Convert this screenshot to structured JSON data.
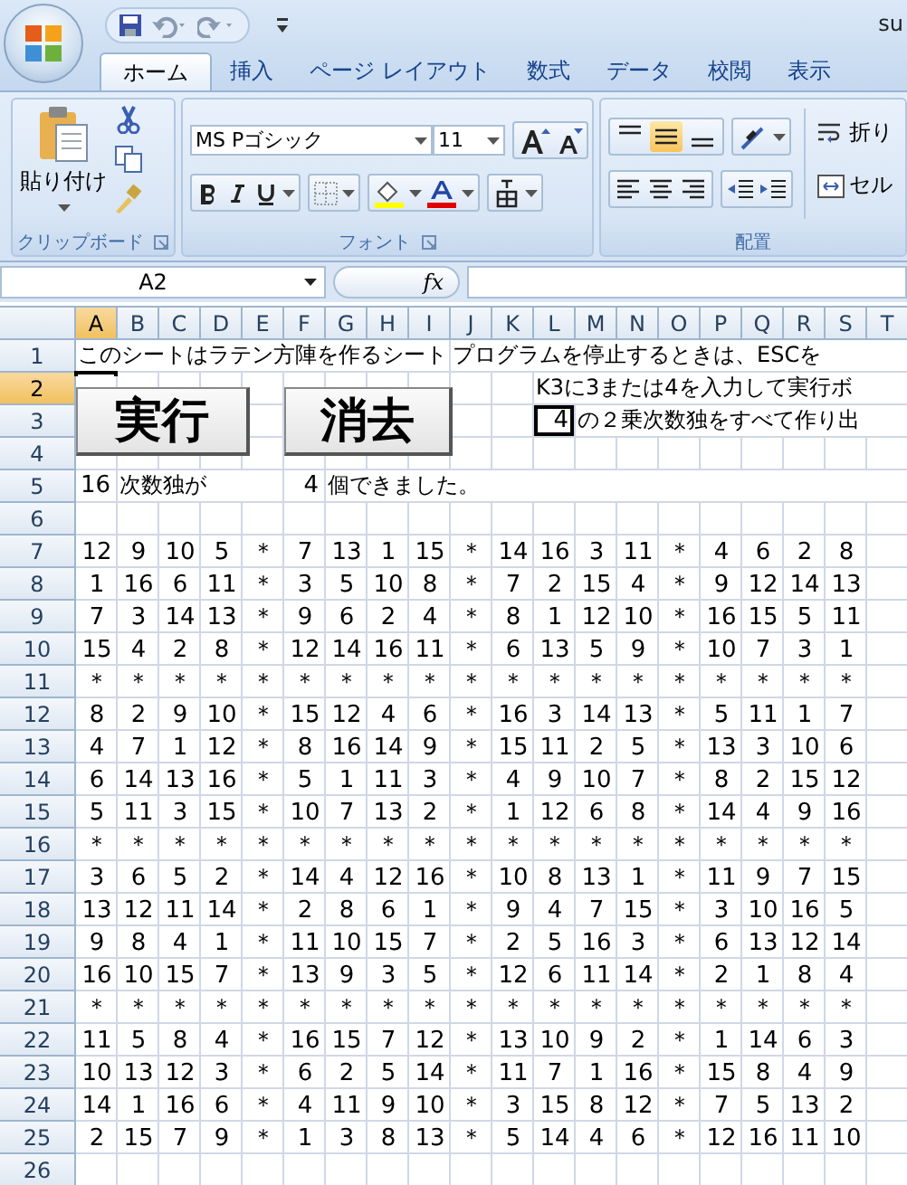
{
  "window": {
    "title": "su"
  },
  "tabs": [
    {
      "label": "ホーム",
      "selected": true
    },
    {
      "label": "挿入",
      "selected": false
    },
    {
      "label": "ページ レイアウト",
      "selected": false
    },
    {
      "label": "数式",
      "selected": false
    },
    {
      "label": "データ",
      "selected": false
    },
    {
      "label": "校閲",
      "selected": false
    },
    {
      "label": "表示",
      "selected": false
    }
  ],
  "ribbon": {
    "clipboard": {
      "label": "クリップボード",
      "paste": "貼り付け"
    },
    "font": {
      "label": "フォント",
      "font_name": "MS Pゴシック",
      "font_size": "11"
    },
    "alignment": {
      "label": "配置",
      "vertical": [
        {
          "kind": "top",
          "selected": false
        },
        {
          "kind": "middle",
          "selected": true
        },
        {
          "kind": "bottom",
          "selected": false
        }
      ],
      "wrap": "折り",
      "merge": "セル"
    }
  },
  "formula_bar": {
    "name_box": "A2",
    "function_label": "fx"
  },
  "sheet": {
    "columns": [
      {
        "label": "A",
        "selected": true
      },
      {
        "label": "B",
        "selected": false
      },
      {
        "label": "C",
        "selected": false
      },
      {
        "label": "D",
        "selected": false
      },
      {
        "label": "E",
        "selected": false
      },
      {
        "label": "F",
        "selected": false
      },
      {
        "label": "G",
        "selected": false
      },
      {
        "label": "H",
        "selected": false
      },
      {
        "label": "I",
        "selected": false
      },
      {
        "label": "J",
        "selected": false
      },
      {
        "label": "K",
        "selected": false
      },
      {
        "label": "L",
        "selected": false
      },
      {
        "label": "M",
        "selected": false
      },
      {
        "label": "N",
        "selected": false
      },
      {
        "label": "O",
        "selected": false
      },
      {
        "label": "P",
        "selected": false
      },
      {
        "label": "Q",
        "selected": false
      },
      {
        "label": "R",
        "selected": false
      },
      {
        "label": "S",
        "selected": false
      },
      {
        "label": "T",
        "selected": false
      }
    ],
    "buttons": [
      {
        "label": "実行"
      },
      {
        "label": "消去"
      }
    ],
    "rows": [
      {
        "number": "1",
        "selected": false,
        "cells": [
          {
            "kind": "text",
            "text": "このシートはラテン方陣を作るシート",
            "boxed": false
          },
          null,
          null,
          null,
          null,
          null,
          null,
          null,
          null,
          {
            "kind": "text",
            "text": "プログラムを停止するときは、ESCを",
            "boxed": false
          }
        ]
      },
      {
        "number": "2",
        "selected": true,
        "cells": [
          null,
          null,
          null,
          null,
          null,
          null,
          null,
          null,
          null,
          null,
          null,
          {
            "kind": "text",
            "text": "K3に3または4を入力して実行ボ",
            "boxed": false
          }
        ]
      },
      {
        "number": "3",
        "selected": false,
        "cells": [
          null,
          null,
          null,
          null,
          null,
          null,
          null,
          null,
          null,
          null,
          null,
          {
            "kind": "number",
            "text": "4",
            "boxed": true
          },
          {
            "kind": "text",
            "text": "の２乗次数独をすべて作り出",
            "boxed": false
          }
        ]
      },
      {
        "number": "4",
        "selected": false
      },
      {
        "number": "5",
        "selected": false,
        "cells": [
          {
            "kind": "number",
            "text": "16",
            "boxed": false
          },
          {
            "kind": "text",
            "text": "次数独が",
            "boxed": false
          },
          null,
          null,
          null,
          {
            "kind": "number",
            "text": "4",
            "boxed": false
          },
          {
            "kind": "text",
            "text": "個できました。",
            "boxed": false
          }
        ]
      },
      {
        "number": "6",
        "selected": false
      },
      {
        "number": "7",
        "selected": false,
        "values": [
          "12",
          "9",
          "10",
          "5",
          "＊",
          "7",
          "13",
          "1",
          "15",
          "＊",
          "14",
          "16",
          "3",
          "11",
          "＊",
          "4",
          "6",
          "2",
          "8"
        ]
      },
      {
        "number": "8",
        "selected": false,
        "values": [
          "1",
          "16",
          "6",
          "11",
          "＊",
          "3",
          "5",
          "10",
          "8",
          "＊",
          "7",
          "2",
          "15",
          "4",
          "＊",
          "9",
          "12",
          "14",
          "13"
        ]
      },
      {
        "number": "9",
        "selected": false,
        "values": [
          "7",
          "3",
          "14",
          "13",
          "＊",
          "9",
          "6",
          "2",
          "4",
          "＊",
          "8",
          "1",
          "12",
          "10",
          "＊",
          "16",
          "15",
          "5",
          "11"
        ]
      },
      {
        "number": "10",
        "selected": false,
        "values": [
          "15",
          "4",
          "2",
          "8",
          "＊",
          "12",
          "14",
          "16",
          "11",
          "＊",
          "6",
          "13",
          "5",
          "9",
          "＊",
          "10",
          "7",
          "3",
          "1"
        ]
      },
      {
        "number": "11",
        "selected": false,
        "values": [
          "＊",
          "＊",
          "＊",
          "＊",
          "＊",
          "＊",
          "＊",
          "＊",
          "＊",
          "＊",
          "＊",
          "＊",
          "＊",
          "＊",
          "＊",
          "＊",
          "＊",
          "＊",
          "＊"
        ]
      },
      {
        "number": "12",
        "selected": false,
        "values": [
          "8",
          "2",
          "9",
          "10",
          "＊",
          "15",
          "12",
          "4",
          "6",
          "＊",
          "16",
          "3",
          "14",
          "13",
          "＊",
          "5",
          "11",
          "1",
          "7"
        ]
      },
      {
        "number": "13",
        "selected": false,
        "values": [
          "4",
          "7",
          "1",
          "12",
          "＊",
          "8",
          "16",
          "14",
          "9",
          "＊",
          "15",
          "11",
          "2",
          "5",
          "＊",
          "13",
          "3",
          "10",
          "6"
        ]
      },
      {
        "number": "14",
        "selected": false,
        "values": [
          "6",
          "14",
          "13",
          "16",
          "＊",
          "5",
          "1",
          "11",
          "3",
          "＊",
          "4",
          "9",
          "10",
          "7",
          "＊",
          "8",
          "2",
          "15",
          "12"
        ]
      },
      {
        "number": "15",
        "selected": false,
        "values": [
          "5",
          "11",
          "3",
          "15",
          "＊",
          "10",
          "7",
          "13",
          "2",
          "＊",
          "1",
          "12",
          "6",
          "8",
          "＊",
          "14",
          "4",
          "9",
          "16"
        ]
      },
      {
        "number": "16",
        "selected": false,
        "values": [
          "＊",
          "＊",
          "＊",
          "＊",
          "＊",
          "＊",
          "＊",
          "＊",
          "＊",
          "＊",
          "＊",
          "＊",
          "＊",
          "＊",
          "＊",
          "＊",
          "＊",
          "＊",
          "＊"
        ]
      },
      {
        "number": "17",
        "selected": false,
        "values": [
          "3",
          "6",
          "5",
          "2",
          "＊",
          "14",
          "4",
          "12",
          "16",
          "＊",
          "10",
          "8",
          "13",
          "1",
          "＊",
          "11",
          "9",
          "7",
          "15"
        ]
      },
      {
        "number": "18",
        "selected": false,
        "values": [
          "13",
          "12",
          "11",
          "14",
          "＊",
          "2",
          "8",
          "6",
          "1",
          "＊",
          "9",
          "4",
          "7",
          "15",
          "＊",
          "3",
          "10",
          "16",
          "5"
        ]
      },
      {
        "number": "19",
        "selected": false,
        "values": [
          "9",
          "8",
          "4",
          "1",
          "＊",
          "11",
          "10",
          "15",
          "7",
          "＊",
          "2",
          "5",
          "16",
          "3",
          "＊",
          "6",
          "13",
          "12",
          "14"
        ]
      },
      {
        "number": "20",
        "selected": false,
        "values": [
          "16",
          "10",
          "15",
          "7",
          "＊",
          "13",
          "9",
          "3",
          "5",
          "＊",
          "12",
          "6",
          "11",
          "14",
          "＊",
          "2",
          "1",
          "8",
          "4"
        ]
      },
      {
        "number": "21",
        "selected": false,
        "values": [
          "＊",
          "＊",
          "＊",
          "＊",
          "＊",
          "＊",
          "＊",
          "＊",
          "＊",
          "＊",
          "＊",
          "＊",
          "＊",
          "＊",
          "＊",
          "＊",
          "＊",
          "＊",
          "＊"
        ]
      },
      {
        "number": "22",
        "selected": false,
        "values": [
          "11",
          "5",
          "8",
          "4",
          "＊",
          "16",
          "15",
          "7",
          "12",
          "＊",
          "13",
          "10",
          "9",
          "2",
          "＊",
          "1",
          "14",
          "6",
          "3"
        ]
      },
      {
        "number": "23",
        "selected": false,
        "values": [
          "10",
          "13",
          "12",
          "3",
          "＊",
          "6",
          "2",
          "5",
          "14",
          "＊",
          "11",
          "7",
          "1",
          "16",
          "＊",
          "15",
          "8",
          "4",
          "9"
        ]
      },
      {
        "number": "24",
        "selected": false,
        "values": [
          "14",
          "1",
          "16",
          "6",
          "＊",
          "4",
          "11",
          "9",
          "10",
          "＊",
          "3",
          "15",
          "8",
          "12",
          "＊",
          "7",
          "5",
          "13",
          "2"
        ]
      },
      {
        "number": "25",
        "selected": false,
        "values": [
          "2",
          "15",
          "7",
          "9",
          "＊",
          "1",
          "3",
          "8",
          "13",
          "＊",
          "5",
          "14",
          "4",
          "6",
          "＊",
          "12",
          "16",
          "11",
          "10"
        ]
      },
      {
        "number": "26",
        "selected": false
      }
    ]
  }
}
